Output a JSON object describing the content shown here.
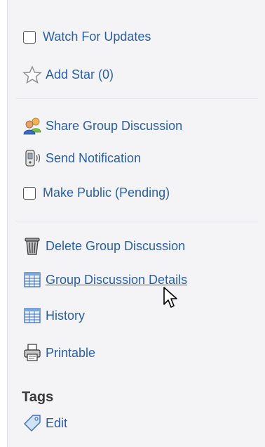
{
  "actions": {
    "watch_label": "Watch For Updates",
    "add_star_label": "Add Star (0)",
    "share_label": "Share Group Discussion",
    "send_notification_label": "Send Notification",
    "make_public_label": "Make Public (Pending)",
    "delete_label": "Delete Group Discussion",
    "details_label": "Group Discussion Details",
    "history_label": "History",
    "printable_label": "Printable"
  },
  "tags": {
    "heading": "Tags",
    "edit_label": "Edit"
  },
  "icons": {
    "star": "star-icon",
    "share": "share-users-icon",
    "notification": "phone-notification-icon",
    "delete": "trash-can-icon",
    "details": "table-grid-icon",
    "history": "table-grid-icon",
    "printable": "printer-icon",
    "tag": "tag-icon"
  },
  "colors": {
    "link": "#2a5fa8",
    "panel_background": "#f4f4f6",
    "heading": "#3a3a3a"
  }
}
